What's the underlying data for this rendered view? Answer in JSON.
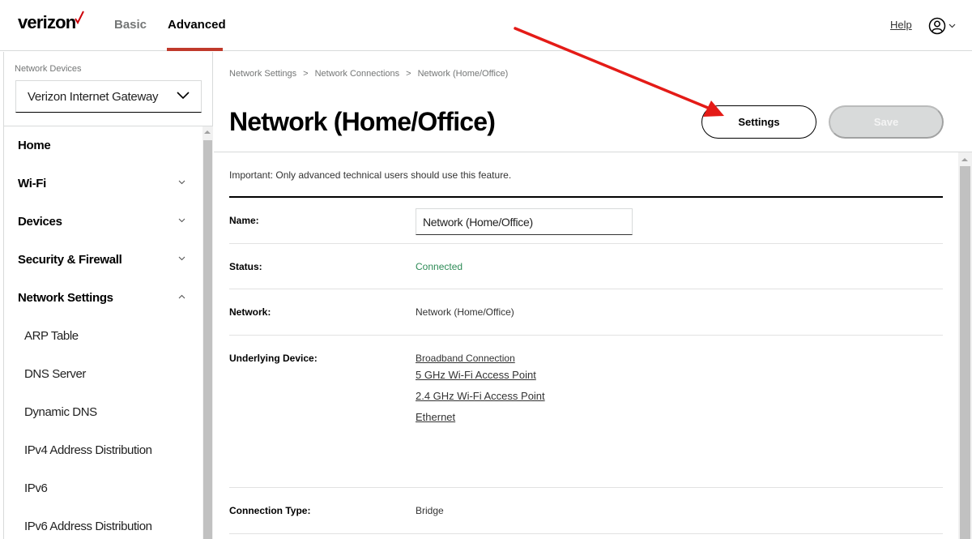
{
  "header": {
    "logo_text": "verizon",
    "tabs": [
      {
        "label": "Basic",
        "active": false
      },
      {
        "label": "Advanced",
        "active": true
      }
    ],
    "help_label": "Help",
    "brand_color": "#cd040b"
  },
  "sidebar": {
    "devices_label": "Network Devices",
    "selected_device": "Verizon Internet Gateway",
    "items": [
      {
        "label": "Home",
        "expandable": false
      },
      {
        "label": "Wi-Fi",
        "expandable": true,
        "expanded": false
      },
      {
        "label": "Devices",
        "expandable": true,
        "expanded": false
      },
      {
        "label": "Security & Firewall",
        "expandable": true,
        "expanded": false
      },
      {
        "label": "Network Settings",
        "expandable": true,
        "expanded": true
      }
    ],
    "subitems": [
      {
        "label": "ARP Table"
      },
      {
        "label": "DNS Server"
      },
      {
        "label": "Dynamic DNS"
      },
      {
        "label": "IPv4 Address Distribution"
      },
      {
        "label": "IPv6"
      },
      {
        "label": "IPv6 Address Distribution"
      }
    ]
  },
  "main": {
    "breadcrumb": [
      "Network Settings",
      "Network Connections",
      "Network (Home/Office)"
    ],
    "title": "Network (Home/Office)",
    "settings_button": "Settings",
    "save_button": "Save",
    "notice": "Important: Only advanced technical users should use this feature.",
    "fields": {
      "name": {
        "label": "Name:",
        "value": "Network (Home/Office)"
      },
      "status": {
        "label": "Status:",
        "value": "Connected",
        "color": "#2e8b57"
      },
      "network": {
        "label": "Network:",
        "value": "Network (Home/Office)"
      },
      "underlying": {
        "label": "Underlying Device:",
        "links": [
          "Broadband Connection",
          "5 GHz Wi-Fi Access Point",
          "2.4 GHz Wi-Fi Access Point",
          "Ethernet"
        ]
      },
      "connection_type": {
        "label": "Connection Type:",
        "value": "Bridge"
      }
    }
  },
  "annotation": {
    "type": "arrow",
    "color": "#e41b17",
    "target": "Settings button"
  }
}
